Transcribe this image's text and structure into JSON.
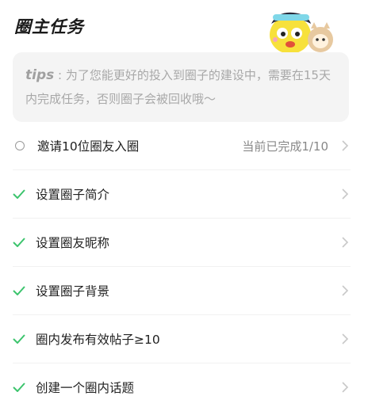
{
  "header": {
    "title": "圈主任务"
  },
  "tips": {
    "label": "tips",
    "separator": ":",
    "text": "为了您能更好的投入到圈子的建设中，需要在15天内完成任务，否则圈子会被回收哦～"
  },
  "tasks": [
    {
      "label": "邀请10位圈友入圈",
      "status": "当前已完成1/10",
      "done": false
    },
    {
      "label": "设置圈子简介",
      "status": "",
      "done": true
    },
    {
      "label": "设置圈友昵称",
      "status": "",
      "done": true
    },
    {
      "label": "设置圈子背景",
      "status": "",
      "done": true
    },
    {
      "label": "圈内发布有效帖子≥10",
      "status": "",
      "done": true
    },
    {
      "label": "创建一个圈内话题",
      "status": "",
      "done": true
    }
  ],
  "colors": {
    "check": "#3cc46d",
    "chevron": "#c8c8c8",
    "tips_bg": "#f4f4f4"
  },
  "icons": {
    "mascot": "mascot-illustration",
    "pending": "circle-icon",
    "done": "check-icon",
    "chevron": "chevron-right-icon"
  }
}
